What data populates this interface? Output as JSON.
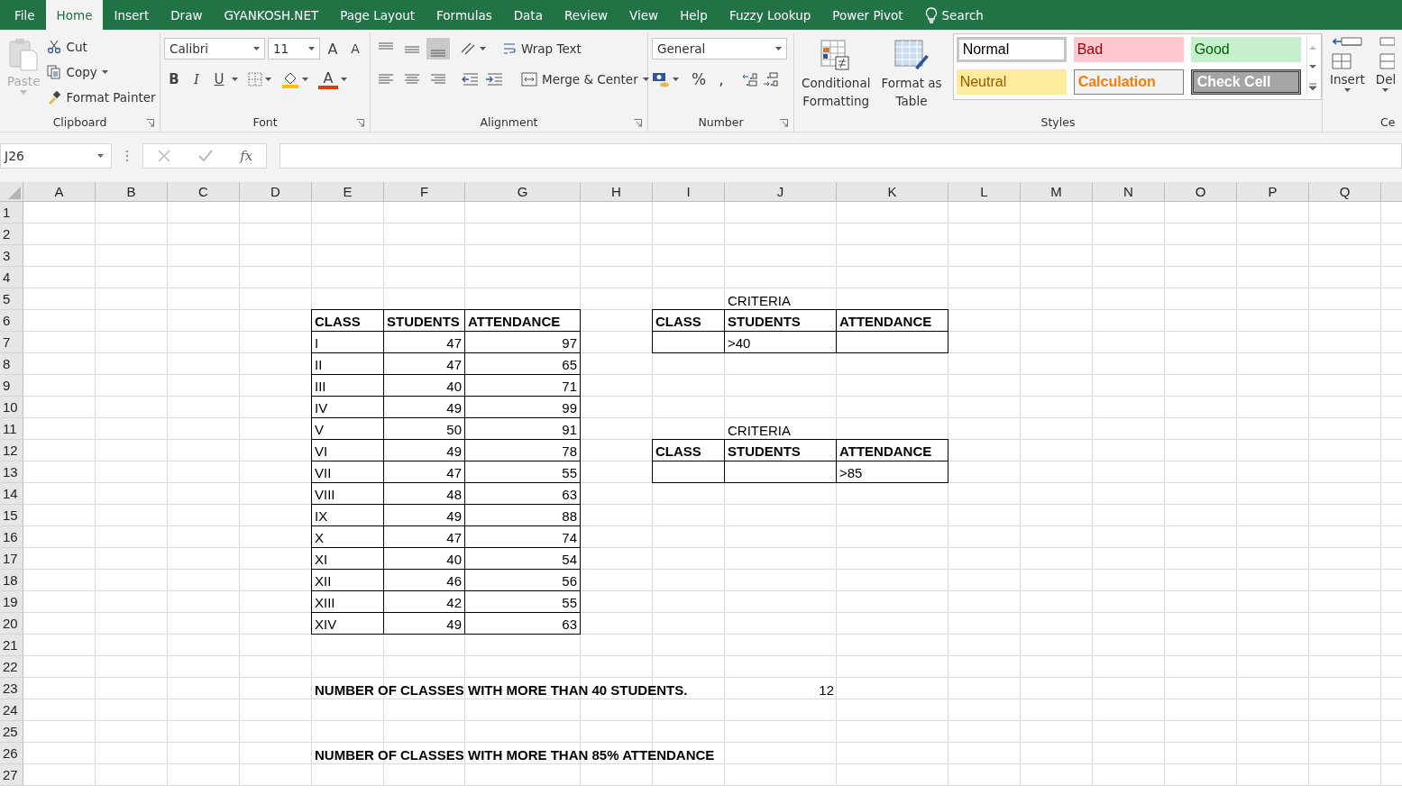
{
  "tabs": [
    {
      "label": "File",
      "selected": false
    },
    {
      "label": "Home",
      "selected": true
    },
    {
      "label": "Insert",
      "selected": false
    },
    {
      "label": "Draw",
      "selected": false
    },
    {
      "label": "GYANKOSH.NET",
      "selected": false
    },
    {
      "label": "Page Layout",
      "selected": false
    },
    {
      "label": "Formulas",
      "selected": false
    },
    {
      "label": "Data",
      "selected": false
    },
    {
      "label": "Review",
      "selected": false
    },
    {
      "label": "View",
      "selected": false
    },
    {
      "label": "Help",
      "selected": false
    },
    {
      "label": "Fuzzy Lookup",
      "selected": false
    },
    {
      "label": "Power Pivot",
      "selected": false
    }
  ],
  "search": {
    "label": "Search"
  },
  "clipboard": {
    "title": "Clipboard",
    "paste": {
      "label": "Paste",
      "disabled": true
    },
    "cut": "Cut",
    "copy": "Copy",
    "format_painter": "Format Painter"
  },
  "font": {
    "title": "Font",
    "name": "Calibri",
    "size": "11",
    "grow": "A",
    "shrink": "A",
    "buttons": [
      {
        "label": "B",
        "kind": "bold"
      },
      {
        "label": "I",
        "kind": "italic"
      },
      {
        "label": "U",
        "kind": "underline"
      }
    ],
    "font_color": "A"
  },
  "alignment": {
    "title": "Alignment",
    "vertical": [
      {
        "selected": false
      },
      {
        "selected": false
      },
      {
        "selected": true
      }
    ],
    "wrap": "Wrap Text",
    "merge": "Merge & Center"
  },
  "number": {
    "title": "Number",
    "format": "General",
    "percent": "%",
    "comma": ","
  },
  "styles": {
    "title": "Styles",
    "conditional": [
      "Conditional",
      "Formatting"
    ],
    "format_table": [
      "Format as",
      "Table"
    ],
    "gallery": [
      {
        "label": "Normal",
        "kind": "normal"
      },
      {
        "label": "Bad",
        "kind": "bad"
      },
      {
        "label": "Good",
        "kind": "good"
      },
      {
        "label": "Neutral",
        "kind": "neutral"
      },
      {
        "label": "Calculation",
        "kind": "calculation"
      },
      {
        "label": "Check Cell",
        "kind": "check"
      }
    ]
  },
  "cells": {
    "title": "Ce",
    "insert": "Insert",
    "delete": "Del"
  },
  "formula_bar": {
    "name_box": "J26",
    "fx": "fx"
  },
  "sheet": {
    "columns": [
      "A",
      "B",
      "C",
      "D",
      "E",
      "F",
      "G",
      "H",
      "I",
      "J",
      "K",
      "L",
      "M",
      "N",
      "O",
      "P",
      "Q"
    ],
    "row_numbers": [
      "1",
      "2",
      "3",
      "4",
      "5",
      "6",
      "7",
      "8",
      "9",
      "10",
      "11",
      "12",
      "13",
      "14",
      "15",
      "16",
      "17",
      "18",
      "19",
      "20",
      "21",
      "22",
      "23",
      "24",
      "25",
      "26",
      "27"
    ],
    "main_table": {
      "columns": [
        "CLASS",
        "STUDENTS",
        "ATTENDANCE"
      ],
      "rows": [
        [
          "I",
          "47",
          "97"
        ],
        [
          "II",
          "47",
          "65"
        ],
        [
          "III",
          "40",
          "71"
        ],
        [
          "IV",
          "49",
          "99"
        ],
        [
          "V",
          "50",
          "91"
        ],
        [
          "VI",
          "49",
          "78"
        ],
        [
          "VII",
          "47",
          "55"
        ],
        [
          "VIII",
          "48",
          "63"
        ],
        [
          "IX",
          "49",
          "88"
        ],
        [
          "X",
          "47",
          "74"
        ],
        [
          "XI",
          "40",
          "54"
        ],
        [
          "XII",
          "46",
          "56"
        ],
        [
          "XIII",
          "42",
          "55"
        ],
        [
          "XIV",
          "49",
          "63"
        ]
      ]
    },
    "criteria": [
      {
        "label": "CRITERIA",
        "columns": [
          "CLASS",
          "STUDENTS",
          "ATTENDANCE"
        ],
        "values": [
          {
            "kind": "blank"
          },
          {
            "kind": "value",
            "text": ">40"
          },
          {
            "kind": "blank"
          }
        ]
      },
      {
        "label": "CRITERIA",
        "columns": [
          "CLASS",
          "STUDENTS",
          "ATTENDANCE"
        ],
        "values": [
          {
            "kind": "blank"
          },
          {
            "kind": "blank"
          },
          {
            "kind": "value",
            "text": ">85"
          }
        ]
      }
    ],
    "results": [
      {
        "label": "NUMBER OF CLASSES WITH MORE THAN 40 STUDENTS.",
        "value": "12"
      },
      {
        "label": "NUMBER OF CLASSES WITH MORE THAN 85% ATTENDANCE"
      }
    ]
  }
}
